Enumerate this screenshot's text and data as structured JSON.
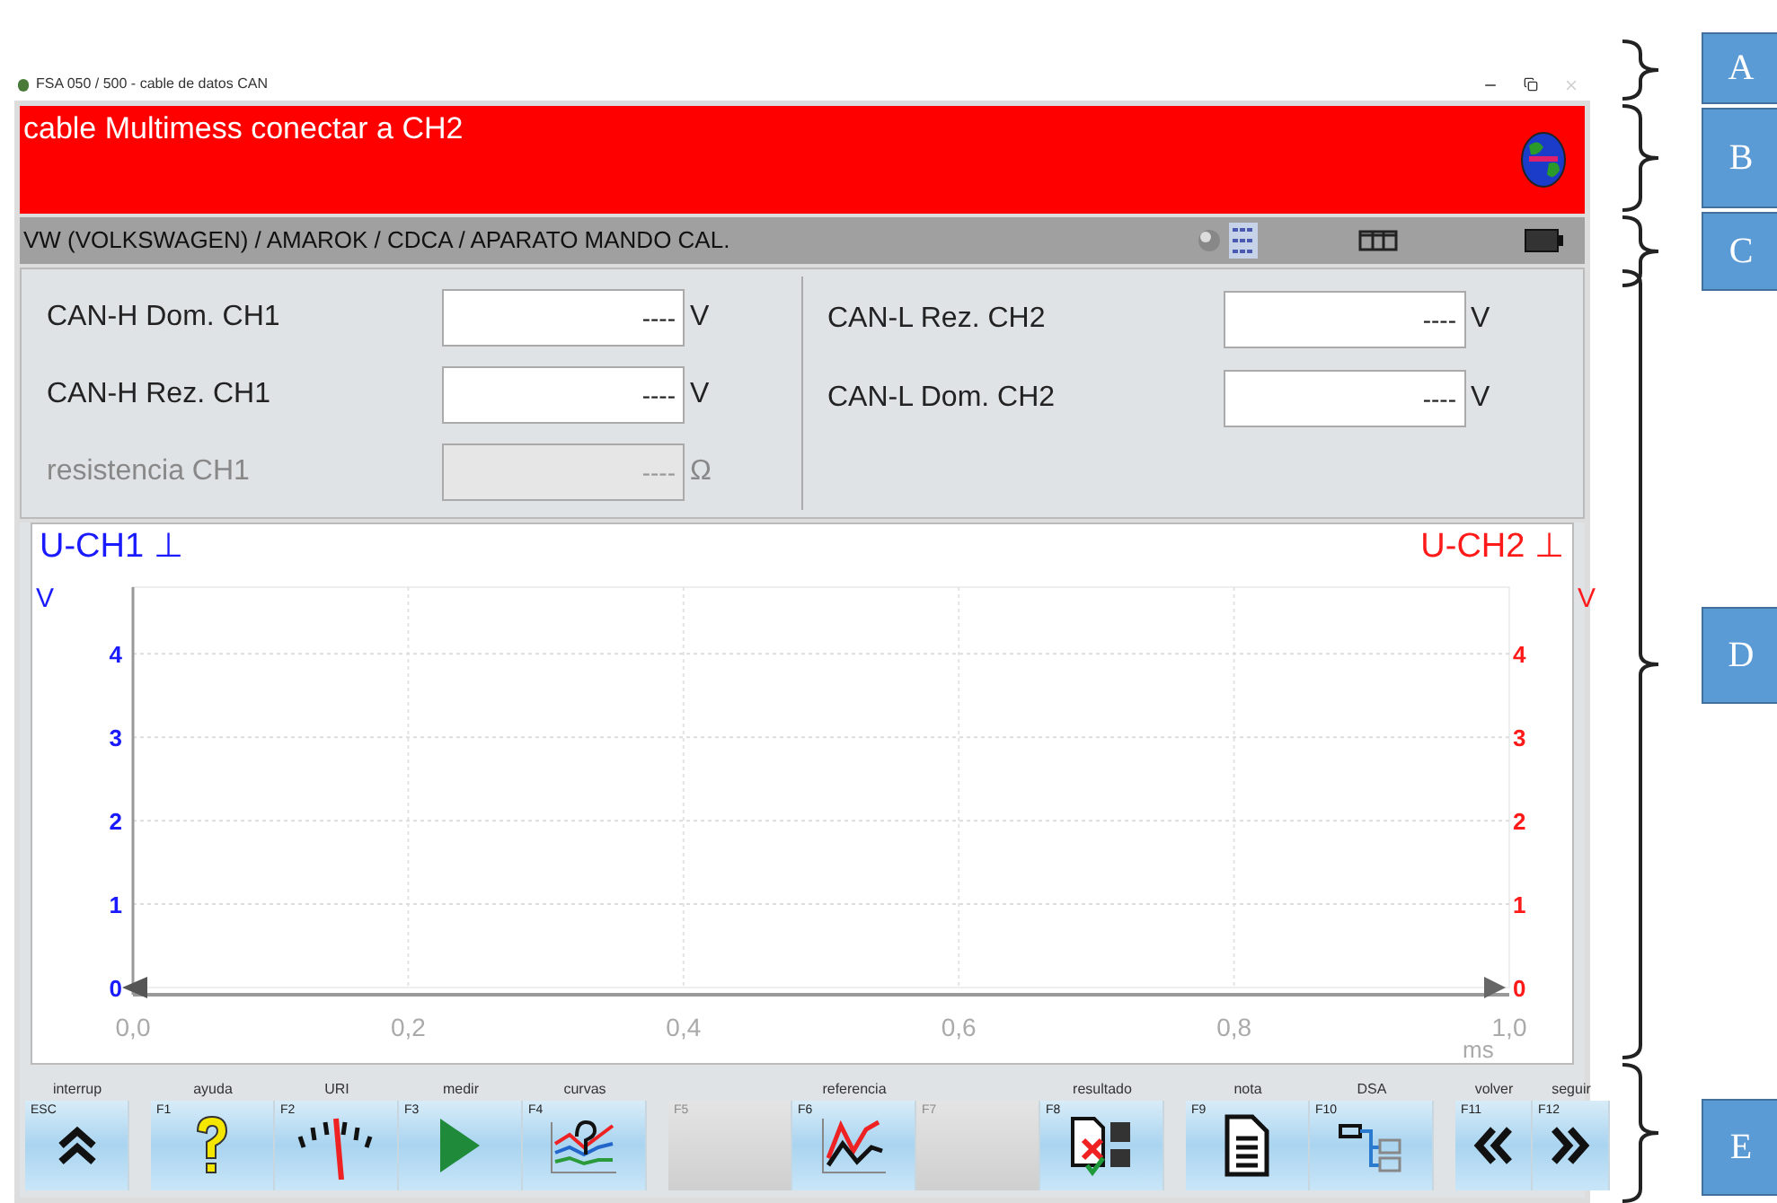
{
  "window": {
    "title": "FSA 050 / 500 - cable de datos CAN"
  },
  "banner": {
    "message": "cable Multimess conectar a CH2"
  },
  "breadcrumb": "VW (VOLKSWAGEN) / AMAROK / CDCA / APARATO MANDO CAL.",
  "fields": [
    {
      "items": [
        {
          "label": "CAN-H Dom. CH1",
          "value": "----",
          "unit": "V",
          "disabled": false
        },
        {
          "label": "CAN-H Rez. CH1",
          "value": "----",
          "unit": "V",
          "disabled": false
        },
        {
          "label": "resistencia CH1",
          "value": "----",
          "unit": "Ω",
          "disabled": true
        }
      ]
    },
    {
      "items": [
        {
          "label": "CAN-L Rez. CH2",
          "value": "----",
          "unit": "V",
          "disabled": false
        },
        {
          "label": "CAN-L Dom. CH2",
          "value": "----",
          "unit": "V",
          "disabled": false
        }
      ]
    }
  ],
  "chart": {
    "left_channel": {
      "name": "U-CH1",
      "symbol": "⊥",
      "unit": "V",
      "color": "#1a1aff"
    },
    "right_channel": {
      "name": "U-CH2",
      "symbol": "⊥",
      "unit": "V",
      "color": "#ff1a1a"
    },
    "x_unit": "ms",
    "right_ticks": [
      "4",
      "3",
      "2",
      "1",
      "0"
    ],
    "chart_data": {
      "type": "line",
      "xlim": [
        0,
        1
      ],
      "ylim": [
        0,
        4.8
      ],
      "xticks": [
        {
          "value": 0,
          "label": "0,0"
        },
        {
          "value": 0.2,
          "label": "0,2"
        },
        {
          "value": 0.4,
          "label": "0,4"
        },
        {
          "value": 0.6,
          "label": "0,6"
        },
        {
          "value": 0.8,
          "label": "0,8"
        },
        {
          "value": 1,
          "label": "1,0"
        }
      ],
      "yticks": [
        {
          "value": 0,
          "label": "0"
        },
        {
          "value": 1,
          "label": "1"
        },
        {
          "value": 2,
          "label": "2"
        },
        {
          "value": 3,
          "label": "3"
        },
        {
          "value": 4,
          "label": "4"
        }
      ],
      "grid": true
    }
  },
  "function_bar": {
    "groups": [
      {
        "buttons": [
          {
            "label": "interrup",
            "key": "ESC",
            "kind": "up",
            "disabled": false
          }
        ]
      },
      {
        "buttons": [
          {
            "label": "ayuda",
            "key": "F1",
            "kind": "help",
            "disabled": false
          },
          {
            "label": "URI",
            "key": "F2",
            "kind": "gauge",
            "disabled": false
          },
          {
            "label": "medir",
            "key": "F3",
            "kind": "play",
            "disabled": false
          },
          {
            "label": "curvas",
            "key": "F4",
            "kind": "curves",
            "disabled": false
          }
        ]
      },
      {
        "buttons": [
          {
            "key": "F5",
            "kind": "none",
            "disabled": true
          },
          {
            "label": "referencia",
            "key": "F6",
            "kind": "reference",
            "disabled": false
          },
          {
            "key": "F7",
            "kind": "none",
            "disabled": true
          },
          {
            "label": "resultado",
            "key": "F8",
            "kind": "result",
            "disabled": false
          }
        ]
      },
      {
        "buttons": [
          {
            "label": "nota",
            "key": "F9",
            "kind": "note",
            "disabled": false
          },
          {
            "label": "DSA",
            "key": "F10",
            "kind": "dsa",
            "disabled": false
          }
        ]
      },
      {
        "buttons": [
          {
            "label": "volver",
            "key": "F11",
            "kind": "back",
            "disabled": false
          },
          {
            "label": "seguir",
            "key": "F12",
            "kind": "forward",
            "disabled": false
          }
        ]
      }
    ]
  },
  "annotations": [
    {
      "letter": "A"
    },
    {
      "letter": "B"
    },
    {
      "letter": "C"
    },
    {
      "letter": "D"
    },
    {
      "letter": "E"
    }
  ]
}
